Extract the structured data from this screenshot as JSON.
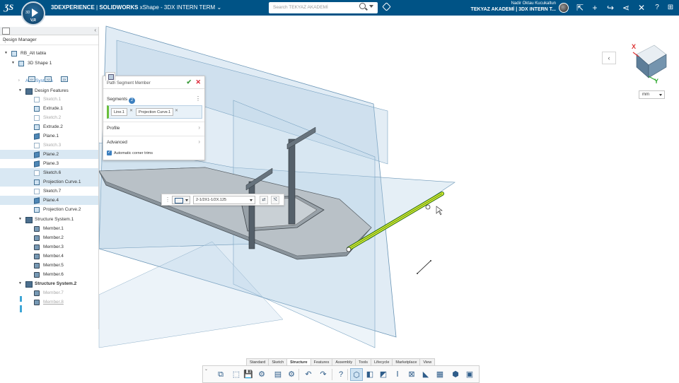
{
  "topbar": {
    "brand": "3DEXPERIENCE",
    "separator": " | ",
    "product": "SOLIDWORKS",
    "app": "xShape - 3DX INTERN TERM",
    "search_placeholder": "Search TEKYAZ AKADEMİ",
    "user_name": "Nadir Oktau Kucukaltun",
    "workspace": "TEKYAZ AKADEMİ | 3DX INTERN T...",
    "compass_version": "V,R",
    "compass_label": "3D",
    "icons": [
      "share-icon",
      "add-icon",
      "forward-icon",
      "network-icon",
      "tools-icon",
      "help-icon"
    ]
  },
  "left_panel": {
    "title": "Design Manager",
    "tree": [
      {
        "label": "RB_Alt tabla",
        "icon": "assembly-icon",
        "state": "normal",
        "expander": "▼"
      },
      {
        "label": "3D Shape 1",
        "icon": "shape-icon",
        "state": "normal",
        "expander": "▼"
      },
      {
        "label": "Axis Systems",
        "icon": "axis-icon",
        "state": "link",
        "expander": "›"
      },
      {
        "label": "Design Features",
        "icon": "features-icon",
        "state": "normal",
        "expander": "▼"
      },
      {
        "label": "Sketch.1",
        "icon": "sketch-icon",
        "state": "dim"
      },
      {
        "label": "Extrude.1",
        "icon": "extrude-icon",
        "state": "normal"
      },
      {
        "label": "Sketch.2",
        "icon": "sketch-icon",
        "state": "dim"
      },
      {
        "label": "Extrude.2",
        "icon": "extrude-icon",
        "state": "normal"
      },
      {
        "label": "Plane.1",
        "icon": "plane-icon",
        "state": "normal"
      },
      {
        "label": "Sketch.3",
        "icon": "sketch-icon",
        "state": "dim"
      },
      {
        "label": "Plane.2",
        "icon": "plane-icon",
        "state": "selected"
      },
      {
        "label": "Plane.3",
        "icon": "plane-icon",
        "state": "normal"
      },
      {
        "label": "Sketch.6",
        "icon": "sketch-icon",
        "state": "selected"
      },
      {
        "label": "Projection Curve.1",
        "icon": "curve-icon",
        "state": "selected"
      },
      {
        "label": "Sketch.7",
        "icon": "sketch-icon",
        "state": "normal"
      },
      {
        "label": "Plane.4",
        "icon": "plane-icon",
        "state": "selected"
      },
      {
        "label": "Projection Curve.2",
        "icon": "curve-icon",
        "state": "normal"
      },
      {
        "label": "Structure System.1",
        "icon": "structure-icon",
        "state": "normal",
        "expander": "▼"
      },
      {
        "label": "Member.1",
        "icon": "member-icon",
        "state": "normal"
      },
      {
        "label": "Member.2",
        "icon": "member-icon",
        "state": "normal"
      },
      {
        "label": "Member.3",
        "icon": "member-icon",
        "state": "normal"
      },
      {
        "label": "Member.4",
        "icon": "member-icon",
        "state": "normal"
      },
      {
        "label": "Member.5",
        "icon": "member-icon",
        "state": "normal"
      },
      {
        "label": "Member.6",
        "icon": "member-icon",
        "state": "normal"
      },
      {
        "label": "Structure System.2",
        "icon": "structure-icon",
        "state": "bold",
        "expander": "▼"
      },
      {
        "label": "Member.7",
        "icon": "member-icon",
        "state": "dim"
      },
      {
        "label": "Member.8",
        "icon": "member-icon",
        "state": "dim-underline"
      }
    ],
    "axis_buttons": [
      "XY",
      "YZ",
      "ZX"
    ]
  },
  "dialog": {
    "title": "Path Segment Member",
    "segments_label": "Segments",
    "segments_count": "2",
    "segments": [
      "Line.1",
      "Projection Curve.1"
    ],
    "profile_label": "Profile",
    "advanced_label": "Advanced",
    "corner_trims_label": "Automatic corner trims",
    "corner_trims_checked": true
  },
  "profile_toolbar": {
    "profile_value": "2-1/2X1-1/2X.125"
  },
  "viewport": {
    "units": "mm",
    "triad_x": "X",
    "triad_y": "Y"
  },
  "bottom_toolbar": {
    "tabs": [
      "Standard",
      "Sketch",
      "Structure",
      "Features",
      "Assembly",
      "Tools",
      "Lifecycle",
      "Marketplace",
      "View"
    ],
    "active_tab": "Structure",
    "tools": [
      "structure-system-icon",
      "member-icon",
      "save-icon",
      "settings-icon",
      "properties-icon",
      "gear-icon",
      "undo-icon",
      "redo-icon",
      "help-icon",
      "path-segment-icon",
      "member-3d-icon",
      "end-cap-icon",
      "profile-icon",
      "trim-icon",
      "gusset-icon",
      "weld-icon",
      "cut-list-icon",
      "plate-icon"
    ]
  },
  "colors": {
    "topbar": "#005386",
    "selection": "#d9e8f3",
    "accent": "#3b7fbf",
    "highlight": "#d6ec2a"
  }
}
